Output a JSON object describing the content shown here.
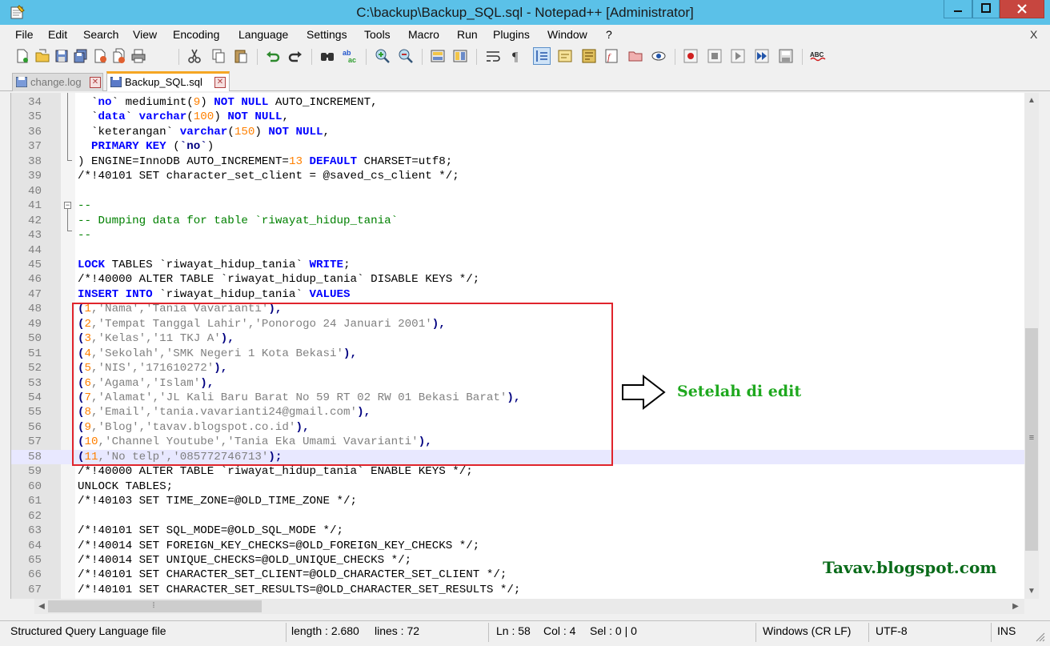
{
  "window": {
    "title": "C:\\backup\\Backup_SQL.sql - Notepad++ [Administrator]",
    "menu_close": "X"
  },
  "menu": [
    "File",
    "Edit",
    "Search",
    "View",
    "Encoding",
    "Language",
    "Settings",
    "Tools",
    "Macro",
    "Run",
    "Plugins",
    "Window",
    "?"
  ],
  "toolbar_icons": [
    "new-file-icon",
    "open-file-icon",
    "save-icon",
    "save-all-icon",
    "close-icon",
    "close-all-icon",
    "print-icon",
    "cut-icon",
    "copy-icon",
    "paste-icon",
    "undo-icon",
    "redo-icon",
    "find-icon",
    "replace-icon",
    "zoom-in-icon",
    "zoom-out-icon",
    "sync-vertical-icon",
    "sync-horizontal-icon",
    "word-wrap-icon",
    "show-all-chars-icon",
    "indent-guide-icon",
    "user-defined-lang-icon",
    "doc-map-icon",
    "function-list-icon",
    "folder-workspace-icon",
    "monitoring-icon",
    "record-macro-icon",
    "stop-macro-icon",
    "play-macro-icon",
    "run-macro-multiple-icon",
    "save-macro-icon",
    "spell-check-icon"
  ],
  "tabs": [
    {
      "label": "change.log",
      "active": false
    },
    {
      "label": "Backup_SQL.sql",
      "active": true
    }
  ],
  "editor": {
    "current_line": "58",
    "lines": [
      {
        "n": "34",
        "parts": [
          [
            "id",
            "  `"
          ],
          [
            "kw",
            "no"
          ],
          [
            "id",
            "` mediumint("
          ],
          [
            "num",
            "9"
          ],
          [
            "id",
            ") "
          ],
          [
            "kw",
            "NOT NULL"
          ],
          [
            "id",
            " AUTO_INCREMENT,"
          ]
        ]
      },
      {
        "n": "35",
        "parts": [
          [
            "id",
            "  `"
          ],
          [
            "kw",
            "data"
          ],
          [
            "id",
            "` "
          ],
          [
            "kw",
            "varchar"
          ],
          [
            "id",
            "("
          ],
          [
            "num",
            "100"
          ],
          [
            "id",
            ") "
          ],
          [
            "kw",
            "NOT NULL"
          ],
          [
            "id",
            ","
          ]
        ]
      },
      {
        "n": "36",
        "parts": [
          [
            "id",
            "  `keterangan` "
          ],
          [
            "kw",
            "varchar"
          ],
          [
            "id",
            "("
          ],
          [
            "num",
            "150"
          ],
          [
            "id",
            ") "
          ],
          [
            "kw",
            "NOT NULL"
          ],
          [
            "id",
            ","
          ]
        ]
      },
      {
        "n": "37",
        "parts": [
          [
            "id",
            "  "
          ],
          [
            "kw",
            "PRIMARY KEY"
          ],
          [
            "id",
            " ("
          ],
          [
            "op",
            "`no`"
          ],
          [
            "id",
            ")"
          ]
        ]
      },
      {
        "n": "38",
        "parts": [
          [
            "id",
            ") ENGINE=InnoDB AUTO_INCREMENT="
          ],
          [
            "num",
            "13"
          ],
          [
            "id",
            " "
          ],
          [
            "kw",
            "DEFAULT"
          ],
          [
            "id",
            " CHARSET=utf8;"
          ]
        ]
      },
      {
        "n": "39",
        "parts": [
          [
            "id",
            "/*!40101 SET character_set_client = @saved_cs_client */;"
          ]
        ]
      },
      {
        "n": "40",
        "parts": []
      },
      {
        "n": "41",
        "parts": [
          [
            "cmt",
            "--"
          ]
        ]
      },
      {
        "n": "42",
        "parts": [
          [
            "cmt",
            "-- Dumping data for table `riwayat_hidup_tania`"
          ]
        ]
      },
      {
        "n": "43",
        "parts": [
          [
            "cmt",
            "--"
          ]
        ]
      },
      {
        "n": "44",
        "parts": []
      },
      {
        "n": "45",
        "parts": [
          [
            "kw",
            "LOCK"
          ],
          [
            "id",
            " TABLES `riwayat_hidup_tania` "
          ],
          [
            "kw",
            "WRITE"
          ],
          [
            "id",
            ";"
          ]
        ]
      },
      {
        "n": "46",
        "parts": [
          [
            "id",
            "/*!40000 ALTER TABLE `riwayat_hidup_tania` DISABLE KEYS */;"
          ]
        ]
      },
      {
        "n": "47",
        "parts": [
          [
            "kw",
            "INSERT INTO"
          ],
          [
            "id",
            " `riwayat_hidup_tania` "
          ],
          [
            "kw",
            "VALUES"
          ]
        ]
      },
      {
        "n": "48",
        "parts": [
          [
            "op",
            "("
          ],
          [
            "num",
            "1"
          ],
          [
            "str",
            ",'Nama','Tania Vavarianti'"
          ],
          [
            "op",
            "),"
          ]
        ]
      },
      {
        "n": "49",
        "parts": [
          [
            "op",
            "("
          ],
          [
            "num",
            "2"
          ],
          [
            "str",
            ",'Tempat Tanggal Lahir','Ponorogo 24 Januari 2001'"
          ],
          [
            "op",
            "),"
          ]
        ]
      },
      {
        "n": "50",
        "parts": [
          [
            "op",
            "("
          ],
          [
            "num",
            "3"
          ],
          [
            "str",
            ",'Kelas','11 TKJ A'"
          ],
          [
            "op",
            "),"
          ]
        ]
      },
      {
        "n": "51",
        "parts": [
          [
            "op",
            "("
          ],
          [
            "num",
            "4"
          ],
          [
            "str",
            ",'Sekolah','SMK Negeri 1 Kota Bekasi'"
          ],
          [
            "op",
            "),"
          ]
        ]
      },
      {
        "n": "52",
        "parts": [
          [
            "op",
            "("
          ],
          [
            "num",
            "5"
          ],
          [
            "str",
            ",'NIS','171610272'"
          ],
          [
            "op",
            "),"
          ]
        ]
      },
      {
        "n": "53",
        "parts": [
          [
            "op",
            "("
          ],
          [
            "num",
            "6"
          ],
          [
            "str",
            ",'Agama','Islam'"
          ],
          [
            "op",
            "),"
          ]
        ]
      },
      {
        "n": "54",
        "parts": [
          [
            "op",
            "("
          ],
          [
            "num",
            "7"
          ],
          [
            "str",
            ",'Alamat','JL Kali Baru Barat No 59 RT 02 RW 01 Bekasi Barat'"
          ],
          [
            "op",
            "),"
          ]
        ]
      },
      {
        "n": "55",
        "parts": [
          [
            "op",
            "("
          ],
          [
            "num",
            "8"
          ],
          [
            "str",
            ",'Email','tania.vavarianti24@gmail.com'"
          ],
          [
            "op",
            "),"
          ]
        ]
      },
      {
        "n": "56",
        "parts": [
          [
            "op",
            "("
          ],
          [
            "num",
            "9"
          ],
          [
            "str",
            ",'Blog','tavav.blogspot.co.id'"
          ],
          [
            "op",
            "),"
          ]
        ]
      },
      {
        "n": "57",
        "parts": [
          [
            "op",
            "("
          ],
          [
            "num",
            "10"
          ],
          [
            "str",
            ",'Channel Youtube','Tania Eka Umami Vavarianti'"
          ],
          [
            "op",
            "),"
          ]
        ]
      },
      {
        "n": "58",
        "parts": [
          [
            "op",
            "("
          ],
          [
            "num",
            "11"
          ],
          [
            "str",
            ",'No telp','085772746713'"
          ],
          [
            "op",
            ");"
          ]
        ]
      },
      {
        "n": "59",
        "parts": [
          [
            "id",
            "/*!40000 ALTER TABLE `riwayat_hidup_tania` ENABLE KEYS */;"
          ]
        ]
      },
      {
        "n": "60",
        "parts": [
          [
            "id",
            "UNLOCK TABLES;"
          ]
        ]
      },
      {
        "n": "61",
        "parts": [
          [
            "id",
            "/*!40103 SET TIME_ZONE=@OLD_TIME_ZONE */;"
          ]
        ]
      },
      {
        "n": "62",
        "parts": []
      },
      {
        "n": "63",
        "parts": [
          [
            "id",
            "/*!40101 SET SQL_MODE=@OLD_SQL_MODE */;"
          ]
        ]
      },
      {
        "n": "64",
        "parts": [
          [
            "id",
            "/*!40014 SET FOREIGN_KEY_CHECKS=@OLD_FOREIGN_KEY_CHECKS */;"
          ]
        ]
      },
      {
        "n": "65",
        "parts": [
          [
            "id",
            "/*!40014 SET UNIQUE_CHECKS=@OLD_UNIQUE_CHECKS */;"
          ]
        ]
      },
      {
        "n": "66",
        "parts": [
          [
            "id",
            "/*!40101 SET CHARACTER_SET_CLIENT=@OLD_CHARACTER_SET_CLIENT */;"
          ]
        ]
      },
      {
        "n": "67",
        "parts": [
          [
            "id",
            "/*!40101 SET CHARACTER_SET_RESULTS=@OLD_CHARACTER_SET_RESULTS */;"
          ]
        ]
      }
    ]
  },
  "annotation": "Setelah di edit",
  "watermark": "Tavav.blogspot.com",
  "status": {
    "file_type": "Structured Query Language file",
    "length": "length : 2.680",
    "lines": "lines : 72",
    "ln": "Ln : 58",
    "col": "Col : 4",
    "sel": "Sel : 0 | 0",
    "eol": "Windows (CR LF)",
    "encoding": "UTF-8",
    "mode": "INS"
  },
  "colors": {
    "titlebar": "#5bc1e8",
    "highlight_box": "#e0242c",
    "annotation": "#1ea81e",
    "watermark": "#0a6b1a"
  }
}
